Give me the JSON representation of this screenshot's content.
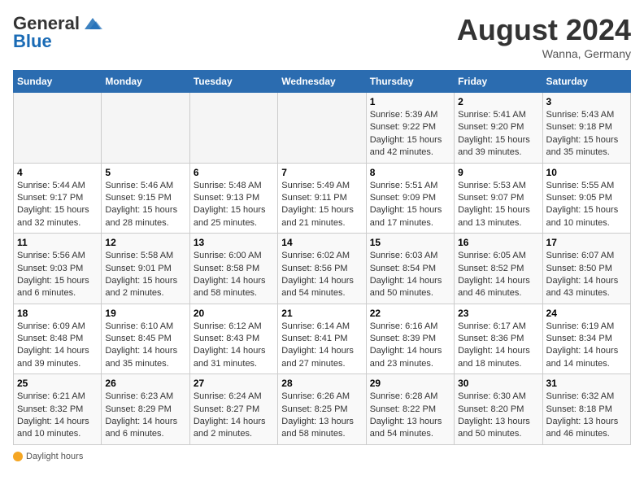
{
  "header": {
    "logo_text_general": "General",
    "logo_text_blue": "Blue",
    "month_year": "August 2024",
    "location": "Wanna, Germany"
  },
  "days_of_week": [
    "Sunday",
    "Monday",
    "Tuesday",
    "Wednesday",
    "Thursday",
    "Friday",
    "Saturday"
  ],
  "weeks": [
    [
      {
        "day": "",
        "sunrise": "",
        "sunset": "",
        "daylight": ""
      },
      {
        "day": "",
        "sunrise": "",
        "sunset": "",
        "daylight": ""
      },
      {
        "day": "",
        "sunrise": "",
        "sunset": "",
        "daylight": ""
      },
      {
        "day": "",
        "sunrise": "",
        "sunset": "",
        "daylight": ""
      },
      {
        "day": "1",
        "sunrise": "Sunrise: 5:39 AM",
        "sunset": "Sunset: 9:22 PM",
        "daylight": "Daylight: 15 hours and 42 minutes."
      },
      {
        "day": "2",
        "sunrise": "Sunrise: 5:41 AM",
        "sunset": "Sunset: 9:20 PM",
        "daylight": "Daylight: 15 hours and 39 minutes."
      },
      {
        "day": "3",
        "sunrise": "Sunrise: 5:43 AM",
        "sunset": "Sunset: 9:18 PM",
        "daylight": "Daylight: 15 hours and 35 minutes."
      }
    ],
    [
      {
        "day": "4",
        "sunrise": "Sunrise: 5:44 AM",
        "sunset": "Sunset: 9:17 PM",
        "daylight": "Daylight: 15 hours and 32 minutes."
      },
      {
        "day": "5",
        "sunrise": "Sunrise: 5:46 AM",
        "sunset": "Sunset: 9:15 PM",
        "daylight": "Daylight: 15 hours and 28 minutes."
      },
      {
        "day": "6",
        "sunrise": "Sunrise: 5:48 AM",
        "sunset": "Sunset: 9:13 PM",
        "daylight": "Daylight: 15 hours and 25 minutes."
      },
      {
        "day": "7",
        "sunrise": "Sunrise: 5:49 AM",
        "sunset": "Sunset: 9:11 PM",
        "daylight": "Daylight: 15 hours and 21 minutes."
      },
      {
        "day": "8",
        "sunrise": "Sunrise: 5:51 AM",
        "sunset": "Sunset: 9:09 PM",
        "daylight": "Daylight: 15 hours and 17 minutes."
      },
      {
        "day": "9",
        "sunrise": "Sunrise: 5:53 AM",
        "sunset": "Sunset: 9:07 PM",
        "daylight": "Daylight: 15 hours and 13 minutes."
      },
      {
        "day": "10",
        "sunrise": "Sunrise: 5:55 AM",
        "sunset": "Sunset: 9:05 PM",
        "daylight": "Daylight: 15 hours and 10 minutes."
      }
    ],
    [
      {
        "day": "11",
        "sunrise": "Sunrise: 5:56 AM",
        "sunset": "Sunset: 9:03 PM",
        "daylight": "Daylight: 15 hours and 6 minutes."
      },
      {
        "day": "12",
        "sunrise": "Sunrise: 5:58 AM",
        "sunset": "Sunset: 9:01 PM",
        "daylight": "Daylight: 15 hours and 2 minutes."
      },
      {
        "day": "13",
        "sunrise": "Sunrise: 6:00 AM",
        "sunset": "Sunset: 8:58 PM",
        "daylight": "Daylight: 14 hours and 58 minutes."
      },
      {
        "day": "14",
        "sunrise": "Sunrise: 6:02 AM",
        "sunset": "Sunset: 8:56 PM",
        "daylight": "Daylight: 14 hours and 54 minutes."
      },
      {
        "day": "15",
        "sunrise": "Sunrise: 6:03 AM",
        "sunset": "Sunset: 8:54 PM",
        "daylight": "Daylight: 14 hours and 50 minutes."
      },
      {
        "day": "16",
        "sunrise": "Sunrise: 6:05 AM",
        "sunset": "Sunset: 8:52 PM",
        "daylight": "Daylight: 14 hours and 46 minutes."
      },
      {
        "day": "17",
        "sunrise": "Sunrise: 6:07 AM",
        "sunset": "Sunset: 8:50 PM",
        "daylight": "Daylight: 14 hours and 43 minutes."
      }
    ],
    [
      {
        "day": "18",
        "sunrise": "Sunrise: 6:09 AM",
        "sunset": "Sunset: 8:48 PM",
        "daylight": "Daylight: 14 hours and 39 minutes."
      },
      {
        "day": "19",
        "sunrise": "Sunrise: 6:10 AM",
        "sunset": "Sunset: 8:45 PM",
        "daylight": "Daylight: 14 hours and 35 minutes."
      },
      {
        "day": "20",
        "sunrise": "Sunrise: 6:12 AM",
        "sunset": "Sunset: 8:43 PM",
        "daylight": "Daylight: 14 hours and 31 minutes."
      },
      {
        "day": "21",
        "sunrise": "Sunrise: 6:14 AM",
        "sunset": "Sunset: 8:41 PM",
        "daylight": "Daylight: 14 hours and 27 minutes."
      },
      {
        "day": "22",
        "sunrise": "Sunrise: 6:16 AM",
        "sunset": "Sunset: 8:39 PM",
        "daylight": "Daylight: 14 hours and 23 minutes."
      },
      {
        "day": "23",
        "sunrise": "Sunrise: 6:17 AM",
        "sunset": "Sunset: 8:36 PM",
        "daylight": "Daylight: 14 hours and 18 minutes."
      },
      {
        "day": "24",
        "sunrise": "Sunrise: 6:19 AM",
        "sunset": "Sunset: 8:34 PM",
        "daylight": "Daylight: 14 hours and 14 minutes."
      }
    ],
    [
      {
        "day": "25",
        "sunrise": "Sunrise: 6:21 AM",
        "sunset": "Sunset: 8:32 PM",
        "daylight": "Daylight: 14 hours and 10 minutes."
      },
      {
        "day": "26",
        "sunrise": "Sunrise: 6:23 AM",
        "sunset": "Sunset: 8:29 PM",
        "daylight": "Daylight: 14 hours and 6 minutes."
      },
      {
        "day": "27",
        "sunrise": "Sunrise: 6:24 AM",
        "sunset": "Sunset: 8:27 PM",
        "daylight": "Daylight: 14 hours and 2 minutes."
      },
      {
        "day": "28",
        "sunrise": "Sunrise: 6:26 AM",
        "sunset": "Sunset: 8:25 PM",
        "daylight": "Daylight: 13 hours and 58 minutes."
      },
      {
        "day": "29",
        "sunrise": "Sunrise: 6:28 AM",
        "sunset": "Sunset: 8:22 PM",
        "daylight": "Daylight: 13 hours and 54 minutes."
      },
      {
        "day": "30",
        "sunrise": "Sunrise: 6:30 AM",
        "sunset": "Sunset: 8:20 PM",
        "daylight": "Daylight: 13 hours and 50 minutes."
      },
      {
        "day": "31",
        "sunrise": "Sunrise: 6:32 AM",
        "sunset": "Sunset: 8:18 PM",
        "daylight": "Daylight: 13 hours and 46 minutes."
      }
    ]
  ],
  "footer": {
    "daylight_label": "Daylight hours"
  }
}
